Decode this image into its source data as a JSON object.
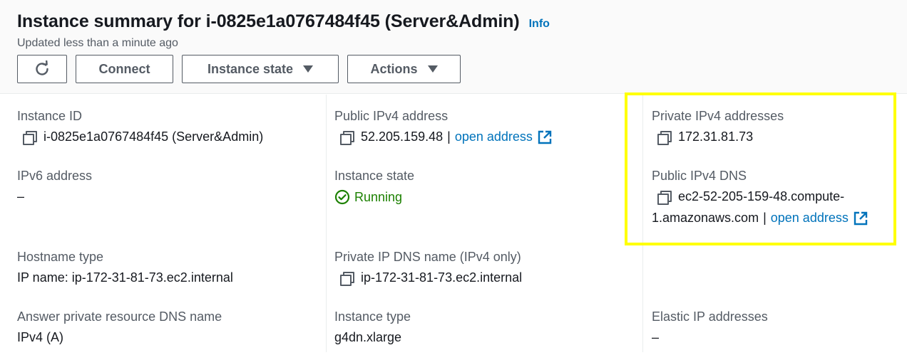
{
  "header": {
    "title": "Instance summary for i-0825e1a0767484f45 (Server&Admin)",
    "info_label": "Info",
    "updated": "Updated less than a minute ago"
  },
  "toolbar": {
    "connect_label": "Connect",
    "instance_state_label": "Instance state",
    "actions_label": "Actions"
  },
  "details": {
    "instance_id": {
      "label": "Instance ID",
      "value": "i-0825e1a0767484f45 (Server&Admin)"
    },
    "public_ipv4": {
      "label": "Public IPv4 address",
      "value": "52.205.159.48",
      "separator": "|",
      "link": "open address"
    },
    "private_ipv4": {
      "label": "Private IPv4 addresses",
      "value": "172.31.81.73"
    },
    "ipv6": {
      "label": "IPv6 address",
      "value": "–"
    },
    "instance_state": {
      "label": "Instance state",
      "value": "Running"
    },
    "public_dns": {
      "label": "Public IPv4 DNS",
      "value_line1": "ec2-52-205-159-48.compute-",
      "value_line2": "1.amazonaws.com",
      "separator": "|",
      "link": "open address"
    },
    "hostname_type": {
      "label": "Hostname type",
      "value": "IP name: ip-172-31-81-73.ec2.internal"
    },
    "private_dns": {
      "label": "Private IP DNS name (IPv4 only)",
      "value": "ip-172-31-81-73.ec2.internal"
    },
    "answer_dns": {
      "label": "Answer private resource DNS name",
      "value": "IPv4 (A)"
    },
    "instance_type": {
      "label": "Instance type",
      "value": "g4dn.xlarge"
    },
    "elastic_ip": {
      "label": "Elastic IP addresses",
      "value": "–"
    }
  },
  "colors": {
    "accent": "#0073bb",
    "running": "#1d8102",
    "highlight": "#ffff00"
  }
}
